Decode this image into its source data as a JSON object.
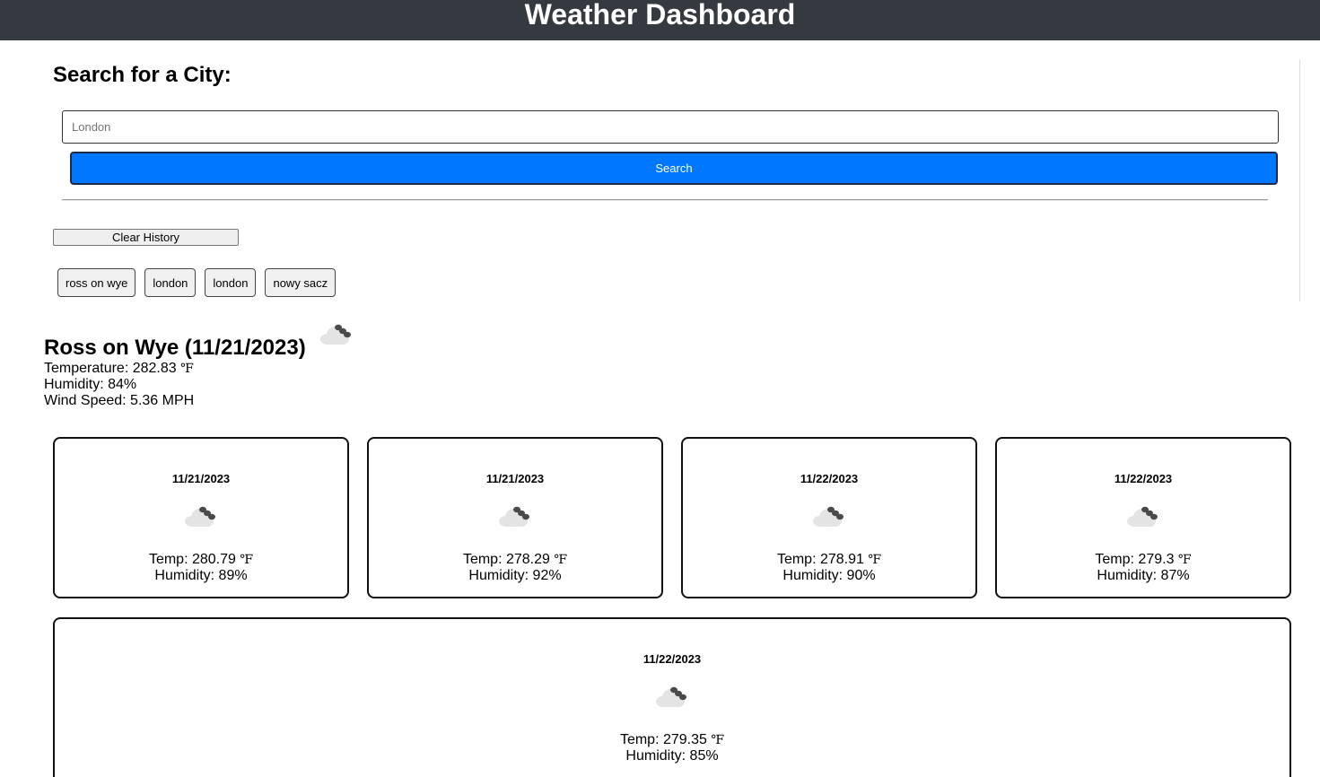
{
  "header": {
    "title": "Weather Dashboard"
  },
  "search": {
    "heading": "Search for a City:",
    "placeholder": "London",
    "button_label": "Search"
  },
  "history": {
    "clear_label": "Clear History",
    "items": [
      {
        "label": "ross on wye"
      },
      {
        "label": "london"
      },
      {
        "label": "london"
      },
      {
        "label": "nowy sacz"
      }
    ]
  },
  "current": {
    "title": "Ross on Wye (11/21/2023)",
    "icon": "cloud-rain-icon",
    "temperature": "Temperature: 282.83",
    "humidity": "Humidity: 84%",
    "wind": "Wind Speed: 5.36 MPH",
    "unit": "℉"
  },
  "forecast": [
    {
      "date": "11/21/2023",
      "icon": "cloud-rain-icon",
      "temp": "Temp: 280.79",
      "unit": "℉",
      "humidity": "Humidity: 89%"
    },
    {
      "date": "11/21/2023",
      "icon": "cloud-rain-icon",
      "temp": "Temp: 278.29",
      "unit": "℉",
      "humidity": "Humidity: 92%"
    },
    {
      "date": "11/22/2023",
      "icon": "cloud-rain-icon",
      "temp": "Temp: 278.91",
      "unit": "℉",
      "humidity": "Humidity: 90%"
    },
    {
      "date": "11/22/2023",
      "icon": "cloud-rain-icon",
      "temp": "Temp: 279.3",
      "unit": "℉",
      "humidity": "Humidity: 87%"
    },
    {
      "date": "11/22/2023",
      "icon": "cloud-rain-icon",
      "temp": "Temp: 279.35",
      "unit": "℉",
      "humidity": "Humidity: 85%"
    }
  ],
  "colors": {
    "header_bg": "#343a40",
    "search_button": "#0077ff"
  }
}
